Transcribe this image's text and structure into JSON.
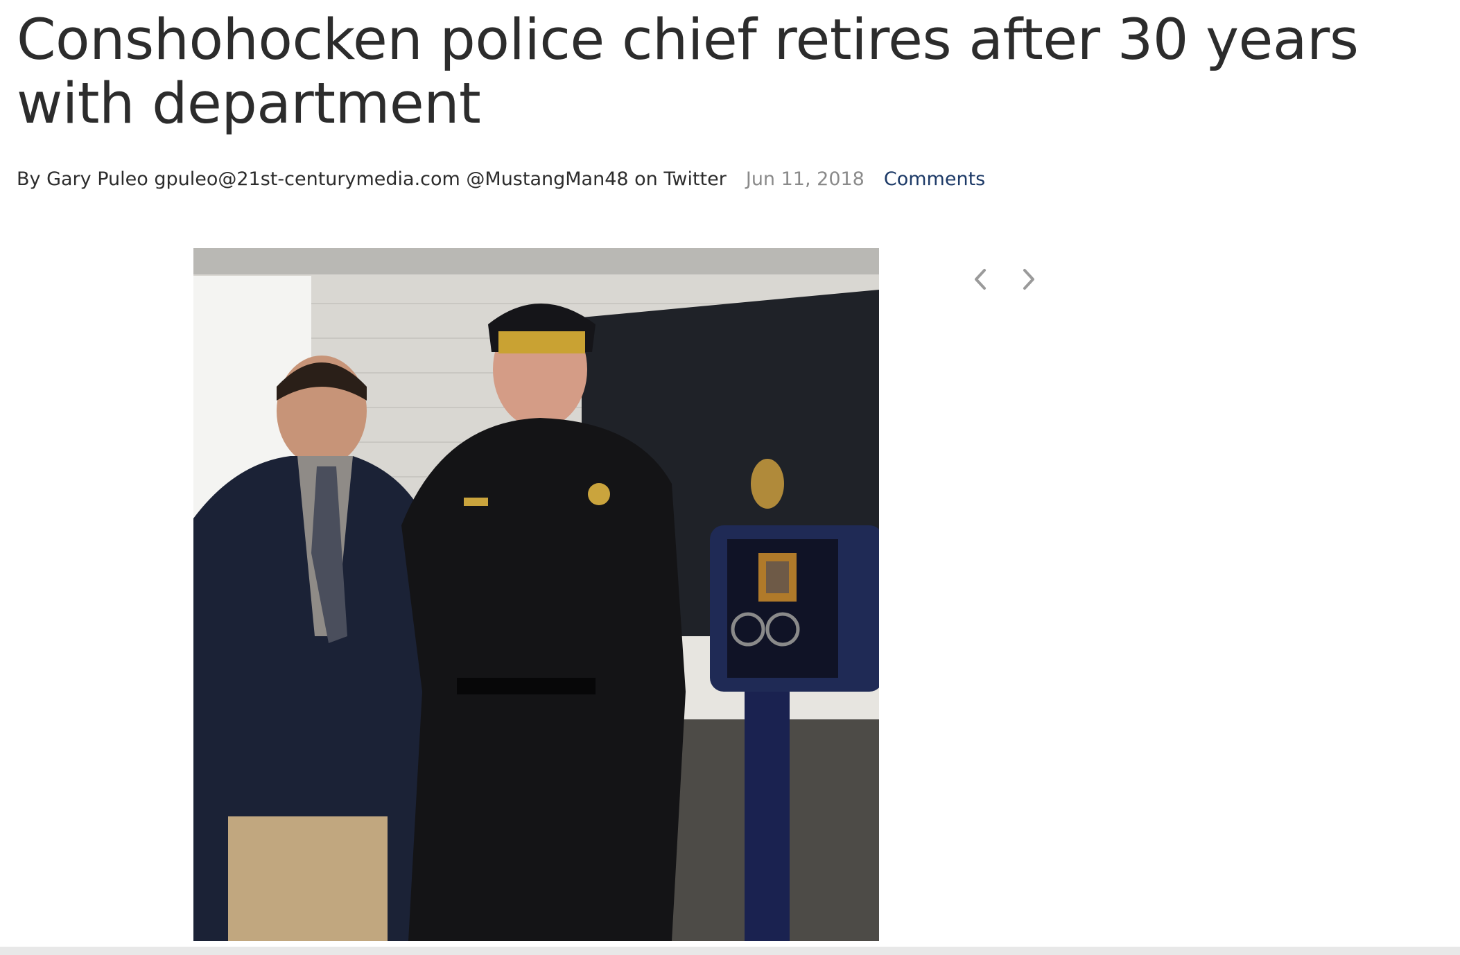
{
  "article": {
    "headline": "Conshohocken police chief retires after 30 years with department",
    "byline": {
      "author": "By Gary Puleo gpuleo@21st-centurymedia.com @MustangMan48 on Twitter",
      "date": "Jun 11, 2018",
      "comments_label": "Comments"
    }
  },
  "gallery": {
    "prev_icon": "chevron-left-icon",
    "next_icon": "chevron-right-icon"
  },
  "colors": {
    "headline": "#2c2c2c",
    "date": "#8a8a8a",
    "comments_link": "#1d3a67",
    "arrow": "#9a9a9a"
  }
}
